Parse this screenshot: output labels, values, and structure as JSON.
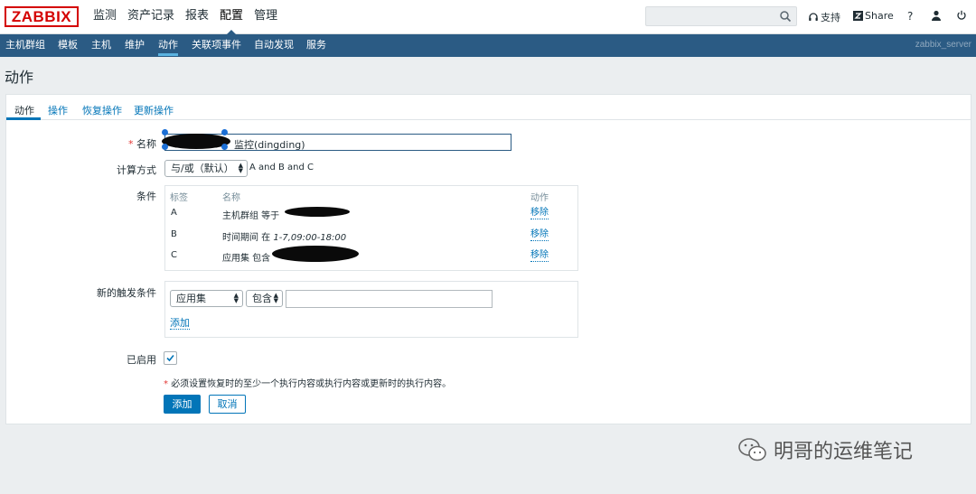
{
  "app": {
    "logo": "ZABBIX",
    "server_name": "zabbix_server"
  },
  "top_menu": [
    {
      "label": "监测"
    },
    {
      "label": "资产记录"
    },
    {
      "label": "报表"
    },
    {
      "label": "配置"
    },
    {
      "label": "管理"
    }
  ],
  "top_menu_selected": "配置",
  "top_links": {
    "support": "支持",
    "share": "Share",
    "help": "?"
  },
  "sub_menu": [
    {
      "label": "主机群组"
    },
    {
      "label": "模板"
    },
    {
      "label": "主机"
    },
    {
      "label": "维护"
    },
    {
      "label": "动作"
    },
    {
      "label": "关联项事件"
    },
    {
      "label": "自动发现"
    },
    {
      "label": "服务"
    }
  ],
  "sub_menu_selected": "动作",
  "page_title": "动作",
  "tabs": [
    {
      "label": "动作"
    },
    {
      "label": "操作"
    },
    {
      "label": "恢复操作"
    },
    {
      "label": "更新操作"
    }
  ],
  "form": {
    "name_label": "名称",
    "name_value": "监控(dingding)",
    "calc_label": "计算方式",
    "calc_value": "与/或（默认）",
    "calc_expression": "A and B and C",
    "conditions_label": "条件",
    "conditions_headers": {
      "label": "标签",
      "name": "名称",
      "action": "动作"
    },
    "conditions": [
      {
        "label": "A",
        "name": "主机群组 等于",
        "detail": "",
        "action": "移除"
      },
      {
        "label": "B",
        "name": "时间期间 在",
        "detail": "1-7,09:00-18:00",
        "action": "移除"
      },
      {
        "label": "C",
        "name": "应用集 包含",
        "detail": "",
        "action": "移除"
      }
    ],
    "new_trigger_label": "新的触发条件",
    "new_trigger_type": "应用集",
    "new_trigger_operator": "包含",
    "new_trigger_value": "",
    "add_link": "添加",
    "enabled_label": "已启用",
    "enabled": true,
    "required_note": "必须设置恢复时的至少一个执行内容或执行内容或更新时的执行内容。",
    "add_button": "添加",
    "cancel_button": "取消"
  },
  "watermark": "明哥的运维笔记"
}
